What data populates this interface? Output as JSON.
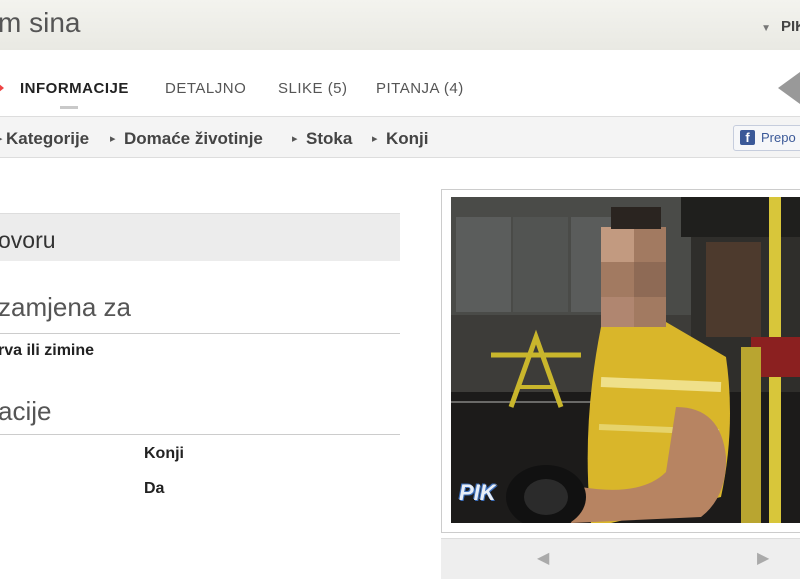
{
  "header": {
    "title": "m sina",
    "user": "PIK"
  },
  "tabs": [
    {
      "label": "INFORMACIJE",
      "active": true
    },
    {
      "label": "DETALJNO",
      "active": false
    },
    {
      "label": "SLIKE (5)",
      "active": false
    },
    {
      "label": "PITANJA (4)",
      "active": false
    }
  ],
  "breadcrumb": {
    "items": [
      "Kategorije",
      "Domaće životinje",
      "Stoka",
      "Konji"
    ]
  },
  "facebook": {
    "label": "Prepo"
  },
  "left": {
    "section_title": "ovoru",
    "subsection_1": "zamjena za",
    "subsection_1_value": "rva ili zimine",
    "subsection_2": "acije",
    "rows": [
      {
        "value": "Konji"
      },
      {
        "value": "Da"
      }
    ]
  },
  "photo": {
    "watermark": "PIK"
  },
  "colors": {
    "accent_red": "#e44444",
    "facebook_blue": "#3b5998",
    "shirt_yellow": "#d9b62a"
  }
}
